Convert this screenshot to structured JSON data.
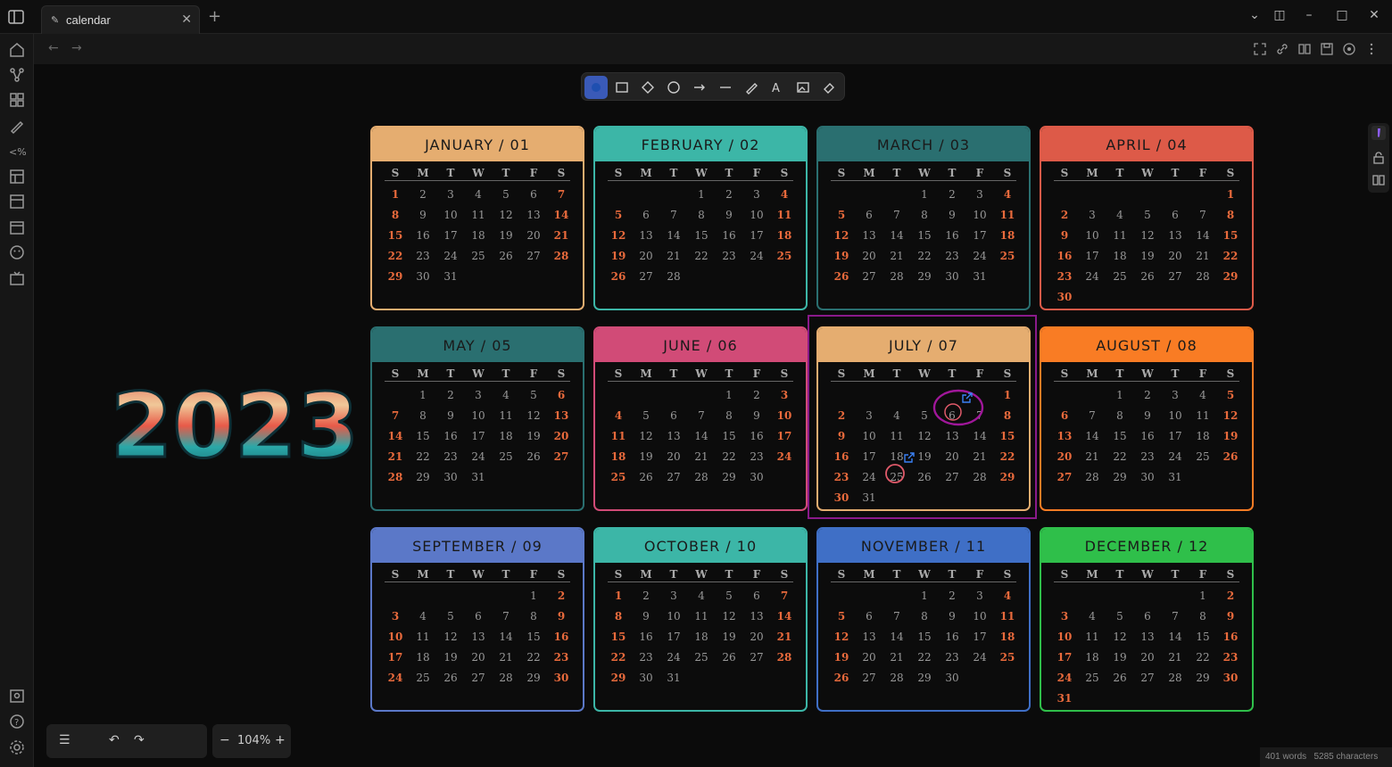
{
  "tab": {
    "title": "calendar"
  },
  "year": "2023",
  "zoom": "104%",
  "status": {
    "words": "401 words",
    "characters": "5285 characters"
  },
  "dow_letters": [
    "S",
    "M",
    "T",
    "W",
    "T",
    "F",
    "S"
  ],
  "colors": {
    "weekend": "#e86a3c",
    "weekday": "#999999",
    "selection": "#8a1a8a",
    "annotation_circle": "#a0179a",
    "annotation_red": "#e05a6a",
    "link_icon": "#3b82f6"
  },
  "months": [
    {
      "title": "JANUARY / 01",
      "color": "#e5ad70",
      "offset": 0,
      "days": 31
    },
    {
      "title": "FEBRUARY / 02",
      "color": "#3cb6a7",
      "offset": 3,
      "days": 28
    },
    {
      "title": "MARCH / 03",
      "color": "#2a6f70",
      "offset": 3,
      "days": 31
    },
    {
      "title": "APRIL / 04",
      "color": "#dd5a48",
      "offset": 6,
      "days": 30
    },
    {
      "title": "MAY / 05",
      "color": "#2a6f70",
      "offset": 1,
      "days": 31
    },
    {
      "title": "JUNE / 06",
      "color": "#d14b77",
      "offset": 4,
      "days": 30
    },
    {
      "title": "JULY / 07",
      "color": "#e5ad70",
      "offset": 6,
      "days": 31
    },
    {
      "title": "AUGUST / 08",
      "color": "#f97c24",
      "offset": 2,
      "days": 31
    },
    {
      "title": "SEPTEMBER / 09",
      "color": "#5b78c8",
      "offset": 5,
      "days": 30
    },
    {
      "title": "OCTOBER / 10",
      "color": "#3cb6a7",
      "offset": 0,
      "days": 31
    },
    {
      "title": "NOVEMBER / 11",
      "color": "#3f6fc6",
      "offset": 3,
      "days": 30
    },
    {
      "title": "DECEMBER / 12",
      "color": "#2fbf4a",
      "offset": 5,
      "days": 31
    }
  ],
  "toolbar": [
    "selection-tool",
    "rectangle-tool",
    "diamond-tool",
    "ellipse-tool",
    "arrow-tool",
    "line-tool",
    "pencil-tool",
    "text-tool",
    "image-tool",
    "eraser-tool"
  ]
}
